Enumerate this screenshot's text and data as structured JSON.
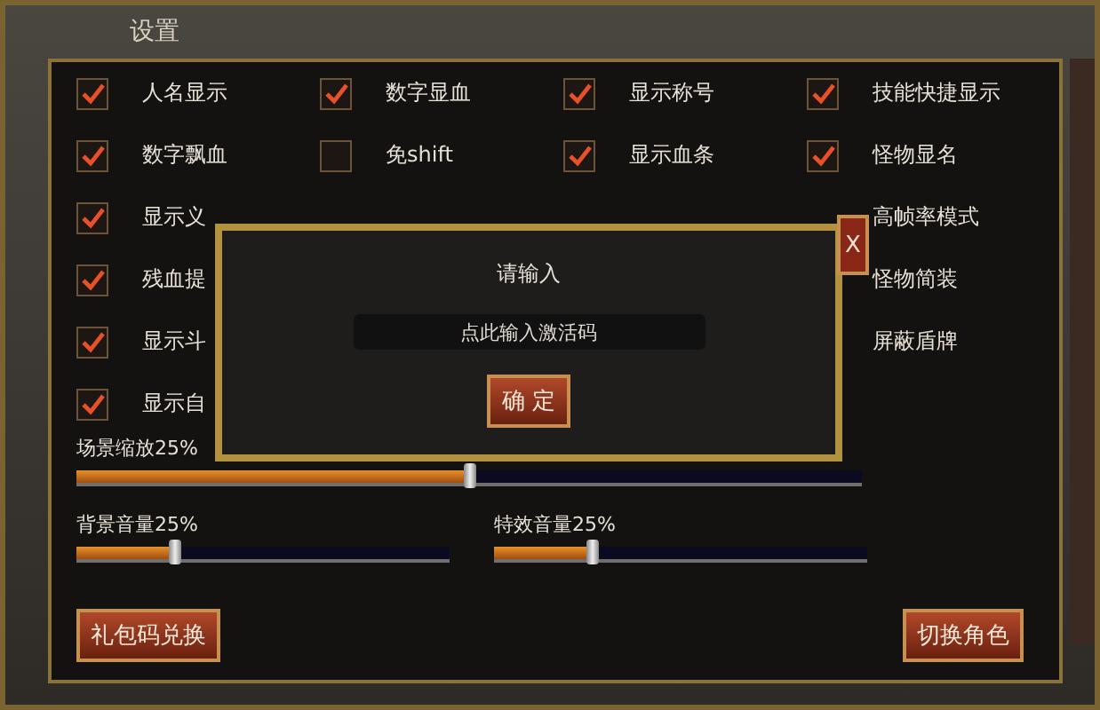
{
  "window": {
    "title": "设置"
  },
  "columns": [
    [
      {
        "kind": "check",
        "label": "人名显示",
        "checked": true
      },
      {
        "kind": "check",
        "label": "数字飘血",
        "checked": true
      },
      {
        "kind": "check",
        "label": "显示义",
        "checked": true
      },
      {
        "kind": "check",
        "label": "残血提",
        "checked": true
      },
      {
        "kind": "check",
        "label": "显示斗",
        "checked": true
      },
      {
        "kind": "check",
        "label": "显示自",
        "checked": true
      }
    ],
    [
      {
        "kind": "check",
        "label": "数字显血",
        "checked": true
      },
      {
        "kind": "check",
        "label": "免shift",
        "checked": false
      }
    ],
    [
      {
        "kind": "check",
        "label": "显示称号",
        "checked": true
      },
      {
        "kind": "check",
        "label": "显示血条",
        "checked": true
      }
    ],
    [
      {
        "kind": "check",
        "label": "技能快捷显示",
        "checked": true
      },
      {
        "kind": "check",
        "label": "怪物显名",
        "checked": true
      },
      {
        "kind": "label",
        "label": "高帧率模式"
      },
      {
        "kind": "label",
        "label": "怪物简装"
      },
      {
        "kind": "label",
        "label": "屏蔽盾牌"
      }
    ]
  ],
  "sliders": [
    {
      "label": "场景缩放25%",
      "level": 0.5
    },
    {
      "label": "背景音量25%",
      "level": 0.26
    },
    {
      "label": "特效音量25%",
      "level": 0.26
    }
  ],
  "buttons": [
    "礼包码兑换",
    "切换角色"
  ],
  "dialog": {
    "title": "请输入",
    "placeholder": "点此输入激活码",
    "button": "确 定",
    "close": "X"
  }
}
